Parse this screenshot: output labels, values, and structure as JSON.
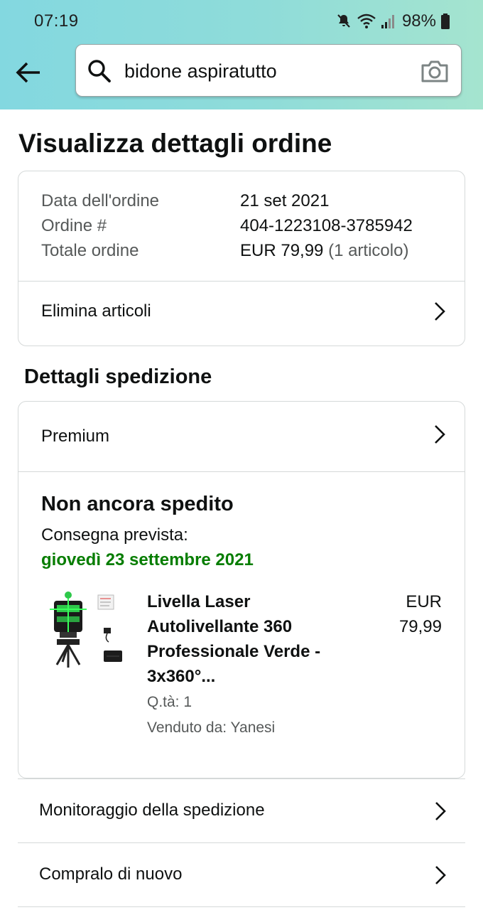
{
  "status_bar": {
    "time": "07:19",
    "battery": "98%",
    "icons": [
      "mute-icon",
      "wifi-icon",
      "signal-icon",
      "battery-icon"
    ]
  },
  "header": {
    "search_value": "bidone aspiratutto",
    "icons": [
      "back-arrow-icon",
      "search-icon",
      "camera-icon"
    ],
    "gradient_colors": [
      "#83d8e0",
      "#a5e4cf"
    ]
  },
  "page": {
    "title": "Visualizza dettagli ordine"
  },
  "order_summary": {
    "date_label": "Data dell'ordine",
    "date_value": "21 set 2021",
    "number_label": "Ordine #",
    "number_value": "404-1223108-3785942",
    "total_label": "Totale ordine",
    "total_value": "EUR 79,99",
    "total_items": "(1 articolo)",
    "delete_items_label": "Elimina articoli"
  },
  "shipment": {
    "section_title": "Dettagli spedizione",
    "shipping_speed": "Premium",
    "status": "Non ancora spedito",
    "delivery_label": "Consegna prevista:",
    "delivery_date": "giovedì 23 settembre 2021",
    "delivery_color": "#067d00",
    "product": {
      "title": "Livella Laser Autolivellante 360 Professionale Verde - 3x360°...",
      "price_currency": "EUR",
      "price_value": "79,99",
      "quantity": "Q.tà: 1",
      "seller": "Venduto da: Yanesi"
    }
  },
  "actions": {
    "track_label": "Monitoraggio della spedizione",
    "buy_again_label": "Compralo di nuovo"
  }
}
